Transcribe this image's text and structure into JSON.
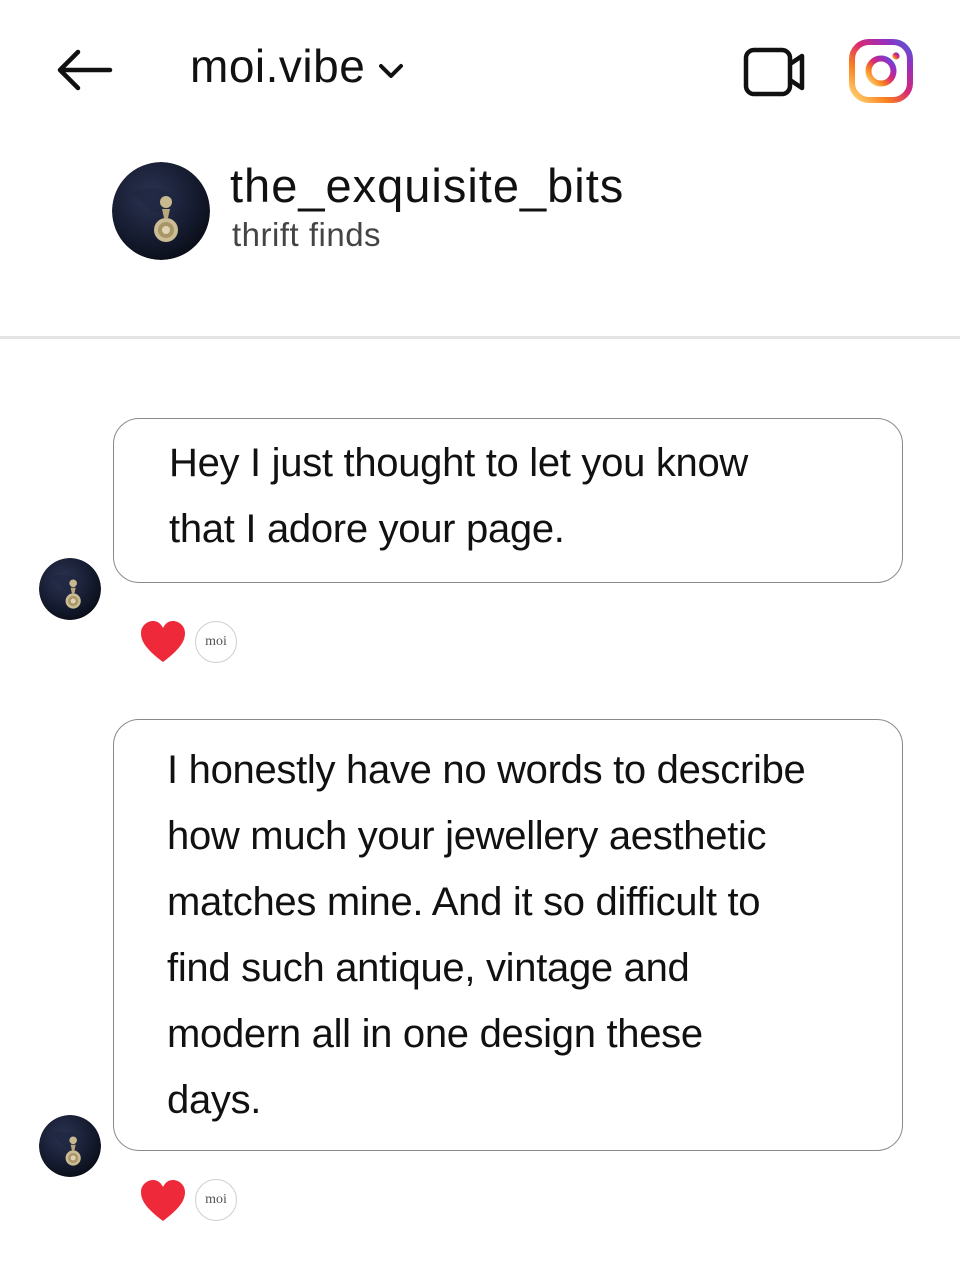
{
  "header": {
    "back_icon": "arrow-left-icon",
    "title": "moi.vibe",
    "title_chevron_icon": "chevron-down-icon",
    "video_icon": "video-camera-icon",
    "instagram_icon": "instagram-icon"
  },
  "profile": {
    "username": "the_exquisite_bits",
    "bio": "thrift finds",
    "avatar_icon": "earring-avatar"
  },
  "messages": [
    {
      "lines": [
        "Hey I just thought to let you know",
        "that  I adore your page."
      ],
      "reaction_icon": "heart-icon",
      "reactor_label": "moi"
    },
    {
      "lines": [
        "I honestly have no words to describe",
        "how much your jewellery aesthetic",
        "matches mine. And it  so difficult to",
        "find such antique, vintage and",
        "modern all  in one design these",
        "days."
      ],
      "reaction_icon": "heart-icon",
      "reactor_label": "moi"
    }
  ],
  "colors": {
    "heart": "#ee2a3a",
    "divider": "#e4e4e4",
    "bubble_border": "#8a8a8a",
    "instagram_gradient": [
      "#feda75",
      "#fa7e1e",
      "#d62976",
      "#962fbf",
      "#4f5bd5"
    ]
  }
}
